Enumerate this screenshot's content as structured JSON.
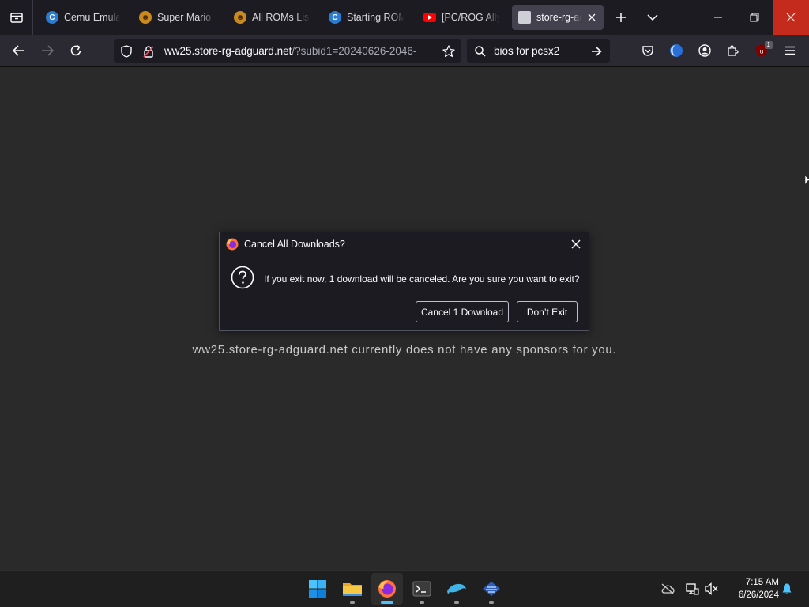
{
  "browser": {
    "tabs": [
      {
        "title": "Cemu Emulator",
        "favicon": "cemu-icon",
        "active": false
      },
      {
        "title": "Super Mario Galaxy",
        "favicon": "romsfun-icon",
        "active": false
      },
      {
        "title": "All ROMs List",
        "favicon": "romsfun-icon",
        "active": false
      },
      {
        "title": "Starting ROM",
        "favicon": "cemu-icon",
        "active": false
      },
      {
        "title": "[PC/ROG Ally]",
        "favicon": "youtube-icon",
        "active": false
      },
      {
        "title": "store-rg-adguard",
        "favicon": "page-icon",
        "active": true
      }
    ],
    "url_host": "ww25.store-rg-adguard.net",
    "url_path": "/?subid1=20240626-2046-",
    "search_text": "bios for pcsx2",
    "extension_badge": "1"
  },
  "page": {
    "sponsor_text": "ww25.store-rg-adguard.net currently does not have any sponsors for you."
  },
  "dialog": {
    "title": "Cancel All Downloads?",
    "message": "If you exit now, 1 download will be canceled. Are you sure you want to exit?",
    "cancel_label": "Cancel 1 Download",
    "dont_exit_label": "Don’t Exit"
  },
  "taskbar": {
    "time": "7:15 AM",
    "date": "6/26/2024",
    "apps": [
      "start",
      "file-explorer",
      "firefox",
      "terminal",
      "dolphin",
      "pcsx2"
    ]
  },
  "colors": {
    "accent": "#4cc2ff",
    "close_red": "#c42b1c",
    "dialog_bg": "#1c1b22",
    "content_bg": "#2b2a2a"
  }
}
